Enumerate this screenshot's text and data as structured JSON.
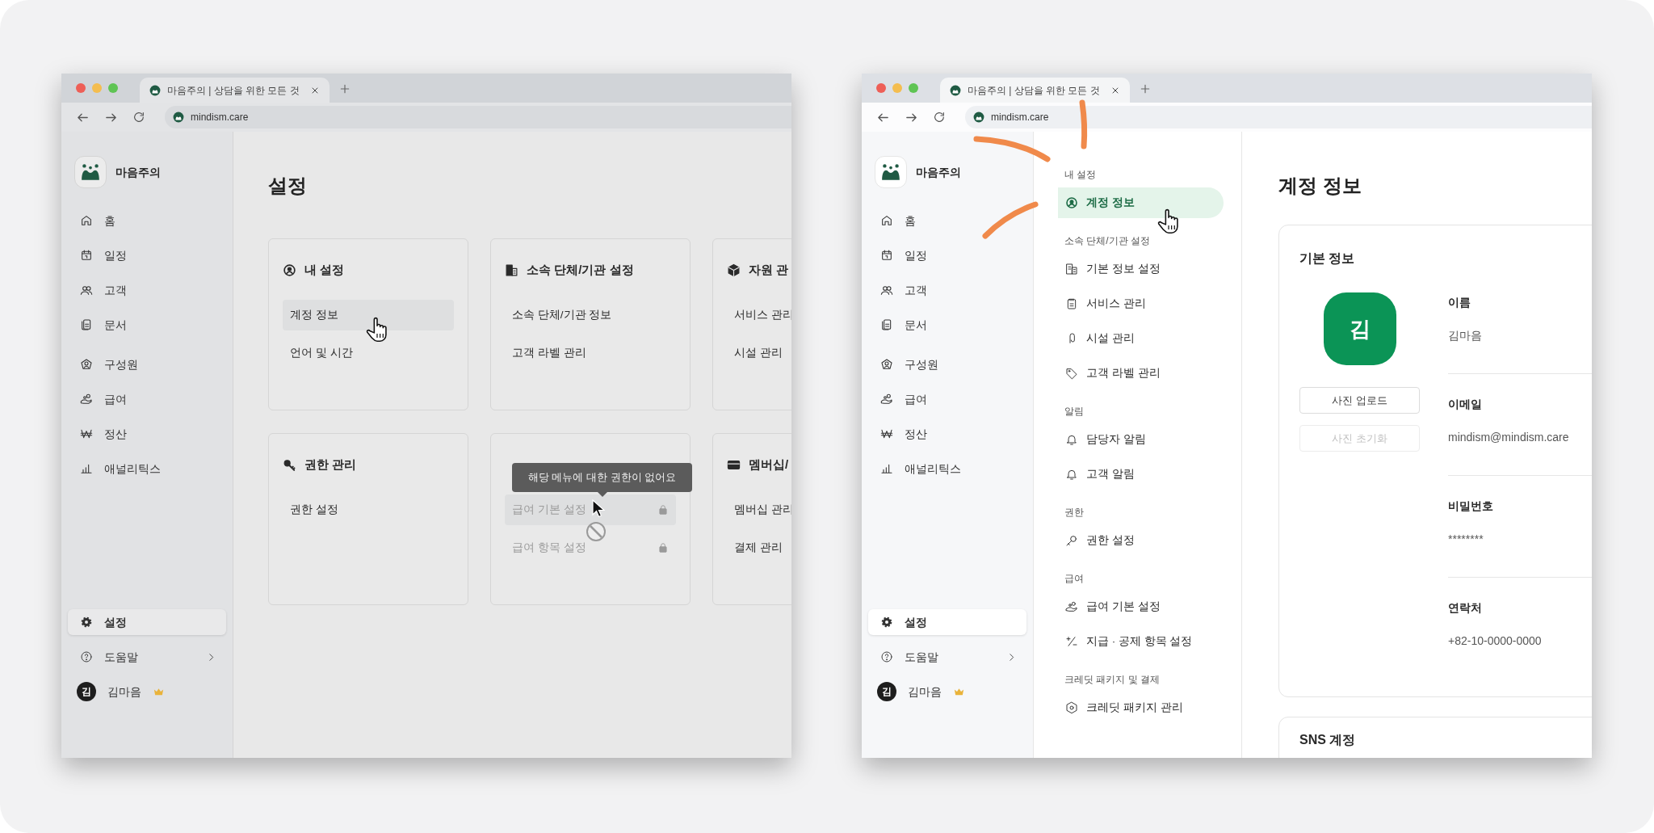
{
  "windows": [
    {
      "kind": "overview",
      "tab": {
        "title": "마음주의 | 상담을 위한 모든 것"
      },
      "address": "mindism.care",
      "sidebar": {
        "brand": "마음주의",
        "groups": [
          [
            {
              "label": "홈",
              "selected": false
            },
            {
              "label": "일정",
              "selected": false
            },
            {
              "label": "고객",
              "selected": false
            },
            {
              "label": "문서",
              "selected": false
            }
          ],
          [
            {
              "label": "구성원",
              "selected": false
            },
            {
              "label": "급여",
              "selected": false
            },
            {
              "label": "정산",
              "selected": false
            },
            {
              "label": "애널리틱스",
              "selected": false
            }
          ]
        ],
        "bottom": [
          {
            "label": "설정",
            "selected": true,
            "expandable": false
          },
          {
            "label": "도움말",
            "selected": false,
            "expandable": true
          }
        ],
        "user": {
          "avatar": "김",
          "name": "김마음"
        }
      },
      "page_title": "설정",
      "cards": [
        {
          "title": "내 설정",
          "items": [
            {
              "label": "계정 정보",
              "hovered": true,
              "disabled": false
            },
            {
              "label": "언어 및 시간",
              "hovered": false,
              "disabled": false
            }
          ]
        },
        {
          "title": "소속 단체/기관 설정",
          "items": [
            {
              "label": "소속 단체/기관 정보",
              "hovered": false,
              "disabled": false
            },
            {
              "label": "고객 라벨 관리",
              "hovered": false,
              "disabled": false
            }
          ]
        },
        {
          "title": "자원 관",
          "items": [
            {
              "label": "서비스 관리"
            },
            {
              "label": "시설 관리"
            }
          ]
        },
        {
          "title": "권한 관리",
          "items": [
            {
              "label": "권한 설정",
              "hovered": false,
              "disabled": false
            }
          ]
        },
        {
          "tooltip": "해당 메뉴에 대한 권한이 없어요",
          "items": [
            {
              "label": "급여 기본 설정",
              "hovered": true,
              "disabled": true
            },
            {
              "label": "급여 항목 설정",
              "hovered": false,
              "disabled": true
            }
          ]
        },
        {
          "title": "멤버십/",
          "items": [
            {
              "label": "멤버십 관리"
            },
            {
              "label": "결제 관리"
            }
          ]
        }
      ]
    },
    {
      "kind": "detail",
      "tab": {
        "title": "마음주의 | 상담을 위한 모든 것"
      },
      "address": "mindism.care",
      "sidebar": {
        "brand": "마음주의",
        "groups": [
          [
            {
              "label": "홈",
              "selected": false
            },
            {
              "label": "일정",
              "selected": false
            },
            {
              "label": "고객",
              "selected": false
            },
            {
              "label": "문서",
              "selected": false
            }
          ],
          [
            {
              "label": "구성원",
              "selected": false
            },
            {
              "label": "급여",
              "selected": false
            },
            {
              "label": "정산",
              "selected": false
            },
            {
              "label": "애널리틱스",
              "selected": false
            }
          ]
        ],
        "bottom": [
          {
            "label": "설정",
            "selected": true,
            "expandable": false
          },
          {
            "label": "도움말",
            "selected": false,
            "expandable": true
          }
        ],
        "user": {
          "avatar": "김",
          "name": "김마음"
        }
      },
      "settings_nav": [
        {
          "label": "내 설정",
          "items": [
            {
              "label": "계정 정보",
              "selected": true,
              "hovered": true
            }
          ]
        },
        {
          "label": "소속 단체/기관 설정",
          "items": [
            {
              "label": "기본 정보 설정",
              "selected": false,
              "hovered": false
            },
            {
              "label": "서비스 관리",
              "selected": false,
              "hovered": false
            },
            {
              "label": "시설 관리",
              "selected": false,
              "hovered": false
            },
            {
              "label": "고객 라벨 관리",
              "selected": false,
              "hovered": false
            }
          ]
        },
        {
          "label": "알림",
          "items": [
            {
              "label": "담당자 알림",
              "selected": false,
              "hovered": false
            },
            {
              "label": "고객 알림",
              "selected": false,
              "hovered": false
            }
          ]
        },
        {
          "label": "권한",
          "items": [
            {
              "label": "권한 설정",
              "selected": false,
              "hovered": false
            }
          ]
        },
        {
          "label": "급여",
          "items": [
            {
              "label": "급여 기본 설정",
              "selected": false,
              "hovered": false
            },
            {
              "label": "지급 · 공제 항목 설정",
              "selected": false,
              "hovered": false
            }
          ]
        },
        {
          "label": "크레딧 패키지 및 결제",
          "items": [
            {
              "label": "크레딧 패키지 관리",
              "selected": false,
              "hovered": false
            }
          ]
        }
      ],
      "page_title": "계정 정보",
      "profile_card": {
        "title": "기본 정보",
        "avatar": "김",
        "buttons": [
          {
            "label": "사진 업로드",
            "disabled": false
          },
          {
            "label": "사진 초기화",
            "disabled": true
          }
        ],
        "fields": [
          {
            "label": "이름",
            "value": "김마음"
          },
          {
            "label": "이메일",
            "value": "mindism@mindism.care"
          },
          {
            "label": "비밀번호",
            "value": "********"
          },
          {
            "label": "연락처",
            "value": "+82-10-0000-0000"
          }
        ]
      },
      "sns_card": {
        "title": "SNS 계정"
      }
    }
  ]
}
